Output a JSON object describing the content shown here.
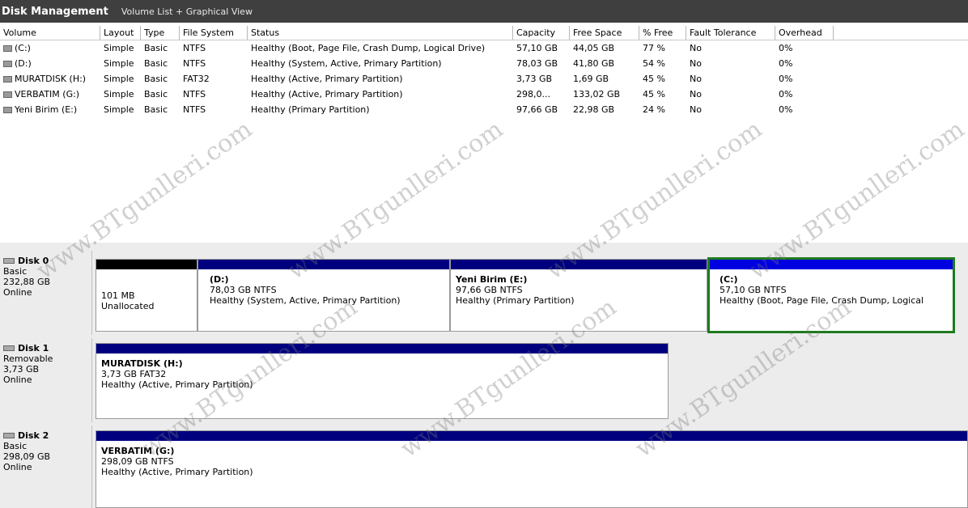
{
  "titlebar": {
    "app": "Disk Management",
    "view": "Volume List + Graphical View"
  },
  "columns": [
    "Volume",
    "Layout",
    "Type",
    "File System",
    "Status",
    "Capacity",
    "Free Space",
    "% Free",
    "Fault Tolerance",
    "Overhead"
  ],
  "volumes": [
    {
      "volume": "(C:)",
      "layout": "Simple",
      "type": "Basic",
      "fs": "NTFS",
      "status": "Healthy (Boot, Page File, Crash Dump, Logical Drive)",
      "capacity": "57,10 GB",
      "free": "44,05 GB",
      "pct": "77 %",
      "fault": "No",
      "overhead": "0%"
    },
    {
      "volume": "(D:)",
      "layout": "Simple",
      "type": "Basic",
      "fs": "NTFS",
      "status": "Healthy (System, Active, Primary Partition)",
      "capacity": "78,03 GB",
      "free": "41,80 GB",
      "pct": "54 %",
      "fault": "No",
      "overhead": "0%"
    },
    {
      "volume": "MURATDISK (H:)",
      "layout": "Simple",
      "type": "Basic",
      "fs": "FAT32",
      "status": "Healthy (Active, Primary Partition)",
      "capacity": "3,73 GB",
      "free": "1,69 GB",
      "pct": "45 %",
      "fault": "No",
      "overhead": "0%"
    },
    {
      "volume": "VERBATIM (G:)",
      "layout": "Simple",
      "type": "Basic",
      "fs": "NTFS",
      "status": "Healthy (Active, Primary Partition)",
      "capacity": "298,0...",
      "free": "133,02 GB",
      "pct": "45 %",
      "fault": "No",
      "overhead": "0%"
    },
    {
      "volume": "Yeni Birim (E:)",
      "layout": "Simple",
      "type": "Basic",
      "fs": "NTFS",
      "status": "Healthy (Primary Partition)",
      "capacity": "97,66 GB",
      "free": "22,98 GB",
      "pct": "24 %",
      "fault": "No",
      "overhead": "0%"
    }
  ],
  "disks": [
    {
      "name": "Disk 0",
      "kind": "Basic",
      "size": "232,88 GB",
      "state": "Online",
      "partitions": [
        {
          "title": "",
          "line1": "101 MB",
          "line2": "Unallocated",
          "bar": "black"
        },
        {
          "title": "(D:)",
          "line1": "78,03 GB NTFS",
          "line2": "Healthy (System, Active, Primary Partition)",
          "bar": "blue"
        },
        {
          "title": "Yeni Birim  (E:)",
          "line1": "97,66 GB NTFS",
          "line2": "Healthy (Primary Partition)",
          "bar": "blue"
        },
        {
          "title": "(C:)",
          "line1": "57,10 GB NTFS",
          "line2": "Healthy (Boot, Page File, Crash Dump, Logical",
          "bar": "blue",
          "selected": true
        }
      ]
    },
    {
      "name": "Disk 1",
      "kind": "Removable",
      "size": "3,73 GB",
      "state": "Online",
      "partitions": [
        {
          "title": "MURATDISK  (H:)",
          "line1": "3,73 GB FAT32",
          "line2": "Healthy (Active, Primary Partition)",
          "bar": "blue"
        }
      ]
    },
    {
      "name": "Disk 2",
      "kind": "Basic",
      "size": "298,09 GB",
      "state": "Online",
      "partitions": [
        {
          "title": "VERBATIM  (G:)",
          "line1": "298,09 GB NTFS",
          "line2": "Healthy (Active, Primary Partition)",
          "bar": "blue"
        }
      ]
    }
  ],
  "watermark": "www.BTgunlleri.com",
  "colors": {
    "partition_bar": "#00007f",
    "unallocated_bar": "#000000",
    "selected_border": "#1f7a1f"
  }
}
